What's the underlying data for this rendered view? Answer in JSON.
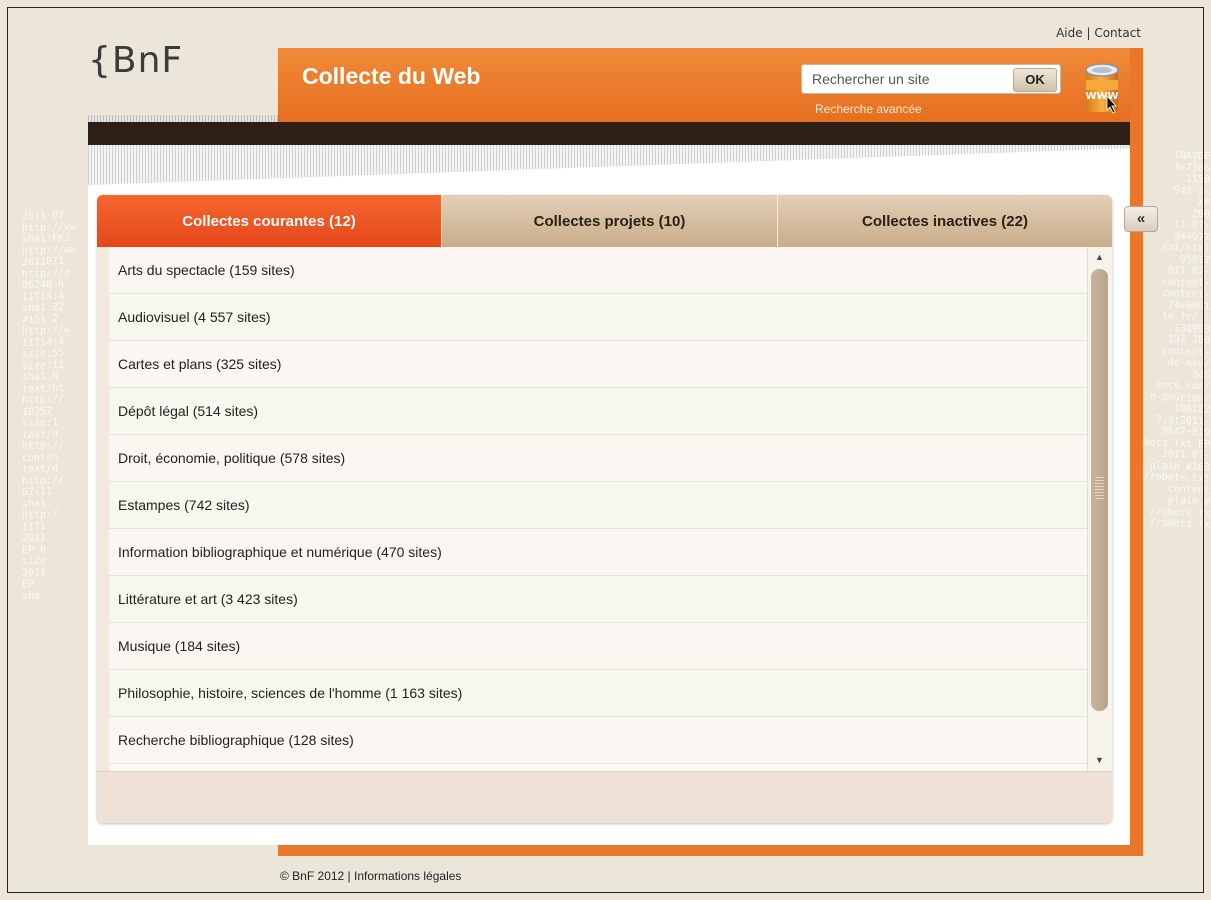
{
  "top_links": {
    "help": "Aide",
    "separator": " | ",
    "contact": "Contact"
  },
  "logo": {
    "text": "{BnF"
  },
  "header": {
    "title": "Collecte du Web"
  },
  "search": {
    "placeholder": "Rechercher un site",
    "button": "OK",
    "advanced_link": "Recherche avancée",
    "icon_text": "WWW"
  },
  "tabs": [
    {
      "label": "Collectes courantes (12)",
      "active": true
    },
    {
      "label": "Collectes projets (10)",
      "active": false
    },
    {
      "label": "Collectes inactives (22)",
      "active": false
    }
  ],
  "collections": [
    "Arts du spectacle (159 sites)",
    "Audiovisuel (4 557 sites)",
    "Cartes et plans (325 sites)",
    "Dépôt légal (514 sites)",
    "Droit, économie, politique (578 sites)",
    "Estampes (742 sites)",
    "Information bibliographique et numérique (470 sites)",
    "Littérature et art (3 423 sites)",
    "Musique (184 sites)",
    "Philosophie, histoire, sciences de l'homme (1 163 sites)",
    "Recherche bibliographique (128 sites)"
  ],
  "collapse_button": "«",
  "footer": {
    "copyright": "© BnF 2012",
    "separator": " | ",
    "legal": "Informations légales"
  },
  "colors": {
    "orange": "#e9772b",
    "active_tab": "#ee5a25",
    "dark_bar": "#2e2016",
    "tab_bg": "#d6bfa0"
  },
  "scrollbar": {
    "position_fraction": 0.0
  }
}
